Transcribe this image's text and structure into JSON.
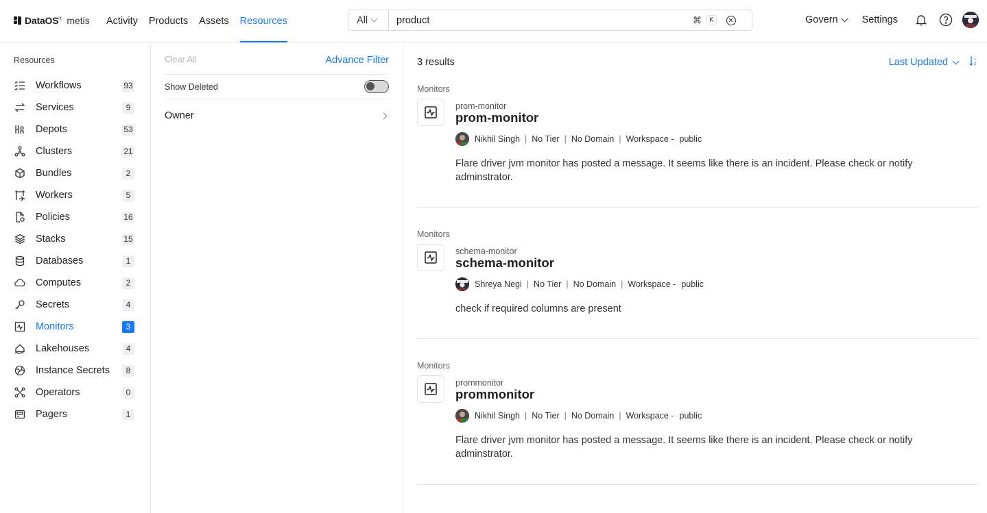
{
  "app": {
    "brand": "DataOS",
    "brand_mark": "®",
    "product": "metis"
  },
  "nav": {
    "items": [
      {
        "label": "Activity"
      },
      {
        "label": "Products"
      },
      {
        "label": "Assets"
      },
      {
        "label": "Resources",
        "active": true
      }
    ]
  },
  "search": {
    "scope": "All",
    "value": "product",
    "shortcut_cmd": "⌘",
    "shortcut_key": "K"
  },
  "header_right": {
    "govern": "Govern",
    "settings": "Settings"
  },
  "sidebar": {
    "title": "Resources",
    "items": [
      {
        "label": "Workflows",
        "count": "93",
        "icon": "workflows-icon"
      },
      {
        "label": "Services",
        "count": "9",
        "icon": "services-icon"
      },
      {
        "label": "Depots",
        "count": "53",
        "icon": "depots-icon"
      },
      {
        "label": "Clusters",
        "count": "21",
        "icon": "clusters-icon"
      },
      {
        "label": "Bundles",
        "count": "2",
        "icon": "bundles-icon"
      },
      {
        "label": "Workers",
        "count": "5",
        "icon": "workers-icon"
      },
      {
        "label": "Policies",
        "count": "16",
        "icon": "policies-icon"
      },
      {
        "label": "Stacks",
        "count": "15",
        "icon": "stacks-icon"
      },
      {
        "label": "Databases",
        "count": "1",
        "icon": "databases-icon"
      },
      {
        "label": "Computes",
        "count": "2",
        "icon": "computes-icon"
      },
      {
        "label": "Secrets",
        "count": "4",
        "icon": "secrets-icon"
      },
      {
        "label": "Monitors",
        "count": "3",
        "icon": "monitors-icon",
        "active": true
      },
      {
        "label": "Lakehouses",
        "count": "4",
        "icon": "lakehouses-icon"
      },
      {
        "label": "Instance Secrets",
        "count": "8",
        "icon": "instance-secrets-icon"
      },
      {
        "label": "Operators",
        "count": "0",
        "icon": "operators-icon"
      },
      {
        "label": "Pagers",
        "count": "1",
        "icon": "pagers-icon"
      }
    ]
  },
  "filters": {
    "clear_all": "Clear All",
    "advance_filter": "Advance Filter",
    "show_deleted": "Show Deleted",
    "owner": "Owner"
  },
  "results": {
    "count_label": "3 results",
    "sort_label": "Last Updated",
    "items": [
      {
        "type": "Monitors",
        "subtitle": "prom-monitor",
        "title": "prom-monitor",
        "owner": "Nikhil Singh",
        "tier": "No Tier",
        "domain": "No Domain",
        "workspace_label": "Workspace -",
        "workspace": "public",
        "description": "Flare driver jvm monitor has posted a message. It seems like there is an incident. Please check or notify adminstrator."
      },
      {
        "type": "Monitors",
        "subtitle": "schema-monitor",
        "title": "schema-monitor",
        "owner": "Shreya Negi",
        "tier": "No Tier",
        "domain": "No Domain",
        "workspace_label": "Workspace -",
        "workspace": "public",
        "description": "check if required columns are present"
      },
      {
        "type": "Monitors",
        "subtitle": "prommonitor",
        "title": "prommonitor",
        "owner": "Nikhil Singh",
        "tier": "No Tier",
        "domain": "No Domain",
        "workspace_label": "Workspace -",
        "workspace": "public",
        "description": "Flare driver jvm monitor has posted a message. It seems like there is an incident. Please check or notify adminstrator."
      }
    ]
  },
  "colors": {
    "accent": "#1677ff"
  }
}
